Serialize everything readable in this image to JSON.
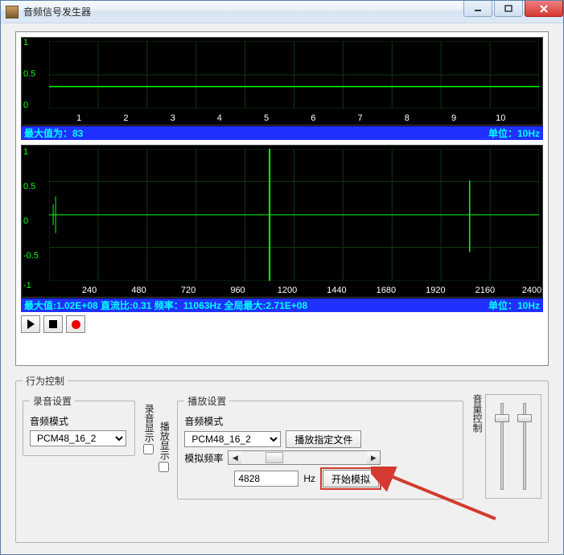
{
  "window": {
    "title": "音频信号发生器"
  },
  "chart_data": [
    {
      "type": "line",
      "xlabel": "",
      "ylabel": "",
      "x_ticks": [
        1,
        2,
        3,
        4,
        5,
        6,
        7,
        8,
        9,
        10
      ],
      "y_ticks": [
        0.0,
        0.5,
        1.0
      ],
      "series": [
        {
          "name": "signal",
          "flat_value": 0.32,
          "xrange": [
            0,
            10.5
          ]
        }
      ],
      "status_left": "最大值为：83",
      "status_right": "单位：10Hz"
    },
    {
      "type": "line",
      "xlabel": "",
      "ylabel": "",
      "x_ticks": [
        240,
        480,
        720,
        960,
        1200,
        1440,
        1680,
        1920,
        2160,
        2400
      ],
      "y_ticks": [
        -1.0,
        -0.5,
        0.0,
        0.5,
        1.0
      ],
      "spikes_x": [
        1080,
        2060
      ],
      "status_left": "最大值:1.02E+08  直流比:0.31  频率：11063Hz 全局最大:2.71E+08",
      "status_right": "单位：10Hz"
    }
  ],
  "behavior": {
    "legend": "行为控制",
    "record": {
      "legend": "录音设置",
      "mode_label": "音频模式",
      "mode_value": "PCM48_16_2"
    },
    "rec_display_label": "录音显示",
    "play_display_label": "播放显示",
    "play": {
      "legend": "播放设置",
      "mode_label": "音频模式",
      "mode_value": "PCM48_16_2",
      "play_file_btn": "播放指定文件",
      "sim_freq_label": "模拟频率",
      "sim_freq_value": "4828",
      "sim_freq_unit": "Hz",
      "start_sim_btn": "开始模拟"
    },
    "volume_label": "音量控制"
  }
}
